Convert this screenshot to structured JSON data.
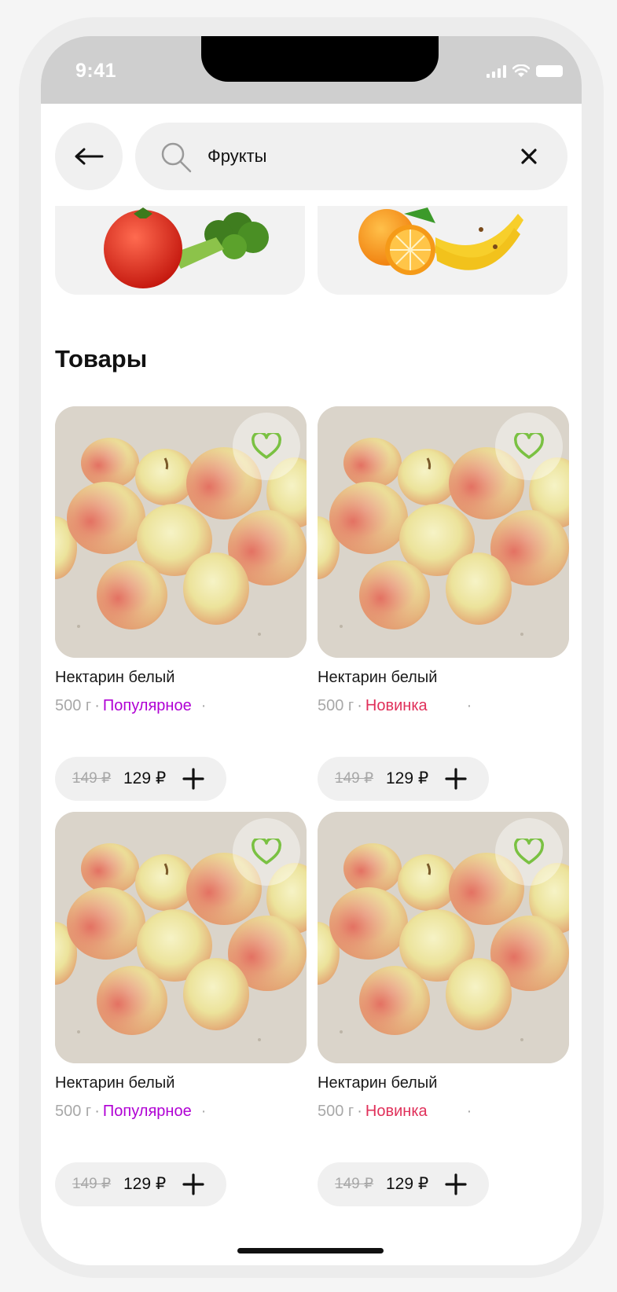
{
  "status_bar": {
    "time": "9:41"
  },
  "search": {
    "query": "Фрукты"
  },
  "section": {
    "title": "Товары"
  },
  "products": [
    {
      "name": "Нектарин белый",
      "weight": "500 г",
      "tag": "Популярное",
      "old_price": "149 ₽",
      "price": "129 ₽"
    },
    {
      "name": "Нектарин белый",
      "weight": "500 г",
      "tag": "Новинка",
      "old_price": "149 ₽",
      "price": "129 ₽"
    },
    {
      "name": "Нектарин белый",
      "weight": "500 г",
      "tag": "Популярное",
      "old_price": "149 ₽",
      "price": "129 ₽"
    },
    {
      "name": "Нектарин белый",
      "weight": "500 г",
      "tag": "Новинка",
      "old_price": "149 ₽",
      "price": "129 ₽"
    }
  ],
  "meta_separator": "·",
  "colors": {
    "accent_green": "#7ac142",
    "tag_popular": "#b000d4",
    "tag_new": "#e0305a"
  }
}
